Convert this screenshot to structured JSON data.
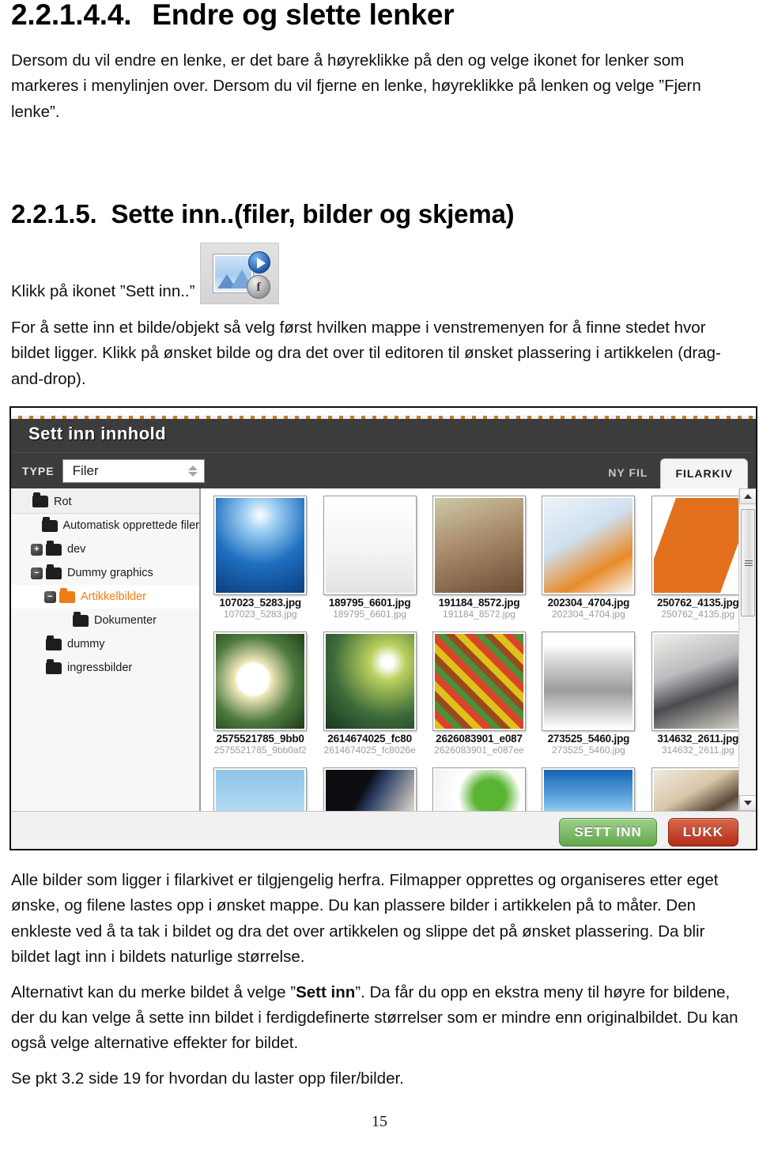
{
  "document": {
    "section1": {
      "number": "2.2.1.4.4.",
      "title": "Endre og slette lenker",
      "paragraph": "Dersom du vil endre en lenke, er det bare å høyreklikke på den og velge ikonet for lenker som markeres i menylinjen over.  Dersom du vil fjerne en lenke, høyreklikke på lenken og velge ”Fjern lenke”."
    },
    "section2": {
      "number": "2.2.1.5.",
      "title": "Sette inn..(filer, bilder og skjema)",
      "icon_caption": "Klikk på ikonet ”Sett inn..”",
      "paragraph": "For å sette inn et bilde/objekt så velg først hvilken mappe i venstremenyen for å finne stedet hvor bildet ligger. Klikk på ønsket bilde og dra det over til editoren til ønsket plassering i artikkelen (drag-and-drop)."
    },
    "after_screenshot": {
      "paragraph1": "Alle bilder som ligger i filarkivet er tilgjengelig herfra. Filmapper opprettes og organiseres etter eget ønske, og filene lastes opp i ønsket mappe. Du kan plassere bilder i artikkelen på to måter. Den enkleste ved å ta tak i bildet og dra det over artikkelen og slippe det på ønsket plassering. Da blir bildet lagt inn i bildets naturlige størrelse.",
      "paragraph2_pre": " Alternativt kan du merke bildet å velge ”",
      "paragraph2_bold": "Sett inn",
      "paragraph2_post": "”. Da får du opp en ekstra meny til høyre for bildene, der du kan velge å sette inn bildet i ferdigdefinerte størrelser som er mindre enn originalbildet. Du kan også velge alternative effekter for bildet.",
      "paragraph3": "Se pkt 3.2 side 19 for hvordan du laster opp filer/bilder."
    },
    "page_number": "15"
  },
  "screenshot": {
    "window_title": "Sett inn innhold",
    "toolbar": {
      "type_label": "TYPE",
      "type_value": "Filer",
      "tab_new_file": "NY FIL",
      "tab_file_archive": "FILARKIV"
    },
    "tree": [
      {
        "label": "Rot",
        "level": 0,
        "toggle": "",
        "folder_color": "black",
        "selected": false
      },
      {
        "label": "Automatisk opprettede filer",
        "level": 1,
        "toggle": "",
        "folder_color": "black",
        "selected": false
      },
      {
        "label": "dev",
        "level": 1,
        "toggle": "+",
        "folder_color": "black",
        "selected": false
      },
      {
        "label": "Dummy graphics",
        "level": 1,
        "toggle": "−",
        "folder_color": "black",
        "selected": false
      },
      {
        "label": "Artikkelbilder",
        "level": 2,
        "toggle": "−",
        "folder_color": "orange",
        "selected": true
      },
      {
        "label": "Dokumenter",
        "level": 3,
        "toggle": "",
        "folder_color": "black",
        "selected": false
      },
      {
        "label": "dummy",
        "level": 1,
        "toggle": "",
        "folder_color": "black",
        "selected": false
      },
      {
        "label": "ingressbilder",
        "level": 1,
        "toggle": "",
        "folder_color": "black",
        "selected": false
      }
    ],
    "files_row1": [
      {
        "name": "107023_5283.jpg",
        "sub": "107023_5283.jpg",
        "thumb": "sunbeams-clouds"
      },
      {
        "name": "189795_6601.jpg",
        "sub": "189795_6601.jpg",
        "thumb": "water-glass"
      },
      {
        "name": "191184_8572.jpg",
        "sub": "191184_8572.jpg",
        "thumb": "handshake"
      },
      {
        "name": "202304_4704.jpg",
        "sub": "202304_4704.jpg",
        "thumb": "browser-logos"
      },
      {
        "name": "250762_4135.jpg",
        "sub": "250762_4135.jpg",
        "thumb": "orange-paper-bag"
      }
    ],
    "files_row2": [
      {
        "name": "2575521785_9bb0",
        "sub": "2575521785_9bb0af2",
        "thumb": "white-flower"
      },
      {
        "name": "2614674025_fc80",
        "sub": "2614674025_fc8026e",
        "thumb": "grass-sunstar"
      },
      {
        "name": "2626083901_e087",
        "sub": "2626083901_e087ee",
        "thumb": "candy-beans"
      },
      {
        "name": "273525_5460.jpg",
        "sub": "273525_5460.jpg",
        "thumb": "rolled-newspaper"
      },
      {
        "name": "314632_2611.jpg",
        "sub": "314632_2611.jpg",
        "thumb": "computer-desks"
      }
    ],
    "files_row3": [
      {
        "thumb": "blue-sky-person"
      },
      {
        "thumb": "man-in-suit"
      },
      {
        "thumb": "green-leaf"
      },
      {
        "thumb": "arms-raised-sky"
      },
      {
        "thumb": "headset-woman"
      }
    ],
    "footer": {
      "insert_button": "SETT INN",
      "close_button": "LUKK"
    },
    "colors": {
      "header_bg": "#3c3c3c",
      "accent_orange": "#c87a28",
      "selected_folder": "#ef7c16",
      "insert_green": "#62a74c",
      "close_red": "#b22d18"
    }
  }
}
